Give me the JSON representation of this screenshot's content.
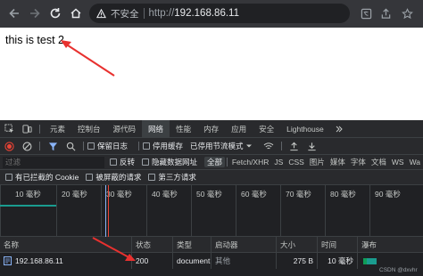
{
  "browser": {
    "insecure_label": "不安全",
    "protocol": "http://",
    "host": "192.168.86.11"
  },
  "page": {
    "text": "this is test 2"
  },
  "devtools": {
    "tabs": [
      "元素",
      "控制台",
      "源代码",
      "网络",
      "性能",
      "内存",
      "应用",
      "安全",
      "Lighthouse"
    ],
    "active_tab": "网络",
    "toolbar": {
      "preserve_log": "保留日志",
      "disable_cache": "停用缓存",
      "throttling": "已停用节流模式"
    },
    "filter": {
      "placeholder": "过滤",
      "invert": "反转",
      "hide_data_urls": "隐藏数据网址",
      "types": [
        "全部",
        "Fetch/XHR",
        "JS",
        "CSS",
        "图片",
        "媒体",
        "字体",
        "文档",
        "WS",
        "Wa"
      ],
      "active_type": "全部"
    },
    "options": {
      "blocked_cookies": "有已拦截的 Cookie",
      "blocked_requests": "被屏蔽的请求",
      "third_party": "第三方请求"
    },
    "timeline_ticks": [
      "10 毫秒",
      "20 毫秒",
      "30 毫秒",
      "40 毫秒",
      "50 毫秒",
      "60 毫秒",
      "70 毫秒",
      "80 毫秒",
      "90 毫秒"
    ],
    "table": {
      "headers": [
        "名称",
        "状态",
        "类型",
        "启动器",
        "大小",
        "时间",
        "瀑布"
      ],
      "rows": [
        {
          "name": "192.168.86.11",
          "status": "200",
          "type": "document",
          "initiator": "其他",
          "size": "275 B",
          "time": "10 毫秒"
        }
      ]
    },
    "watermark": "CSDN @dxvhr",
    "colors": {
      "accent": "#8ab4f8",
      "record": "#ea4335",
      "annotation_arrow": "#e8312f",
      "waterfall_green": "#0f9d58",
      "waterfall_teal": "#1a9c8f"
    }
  }
}
